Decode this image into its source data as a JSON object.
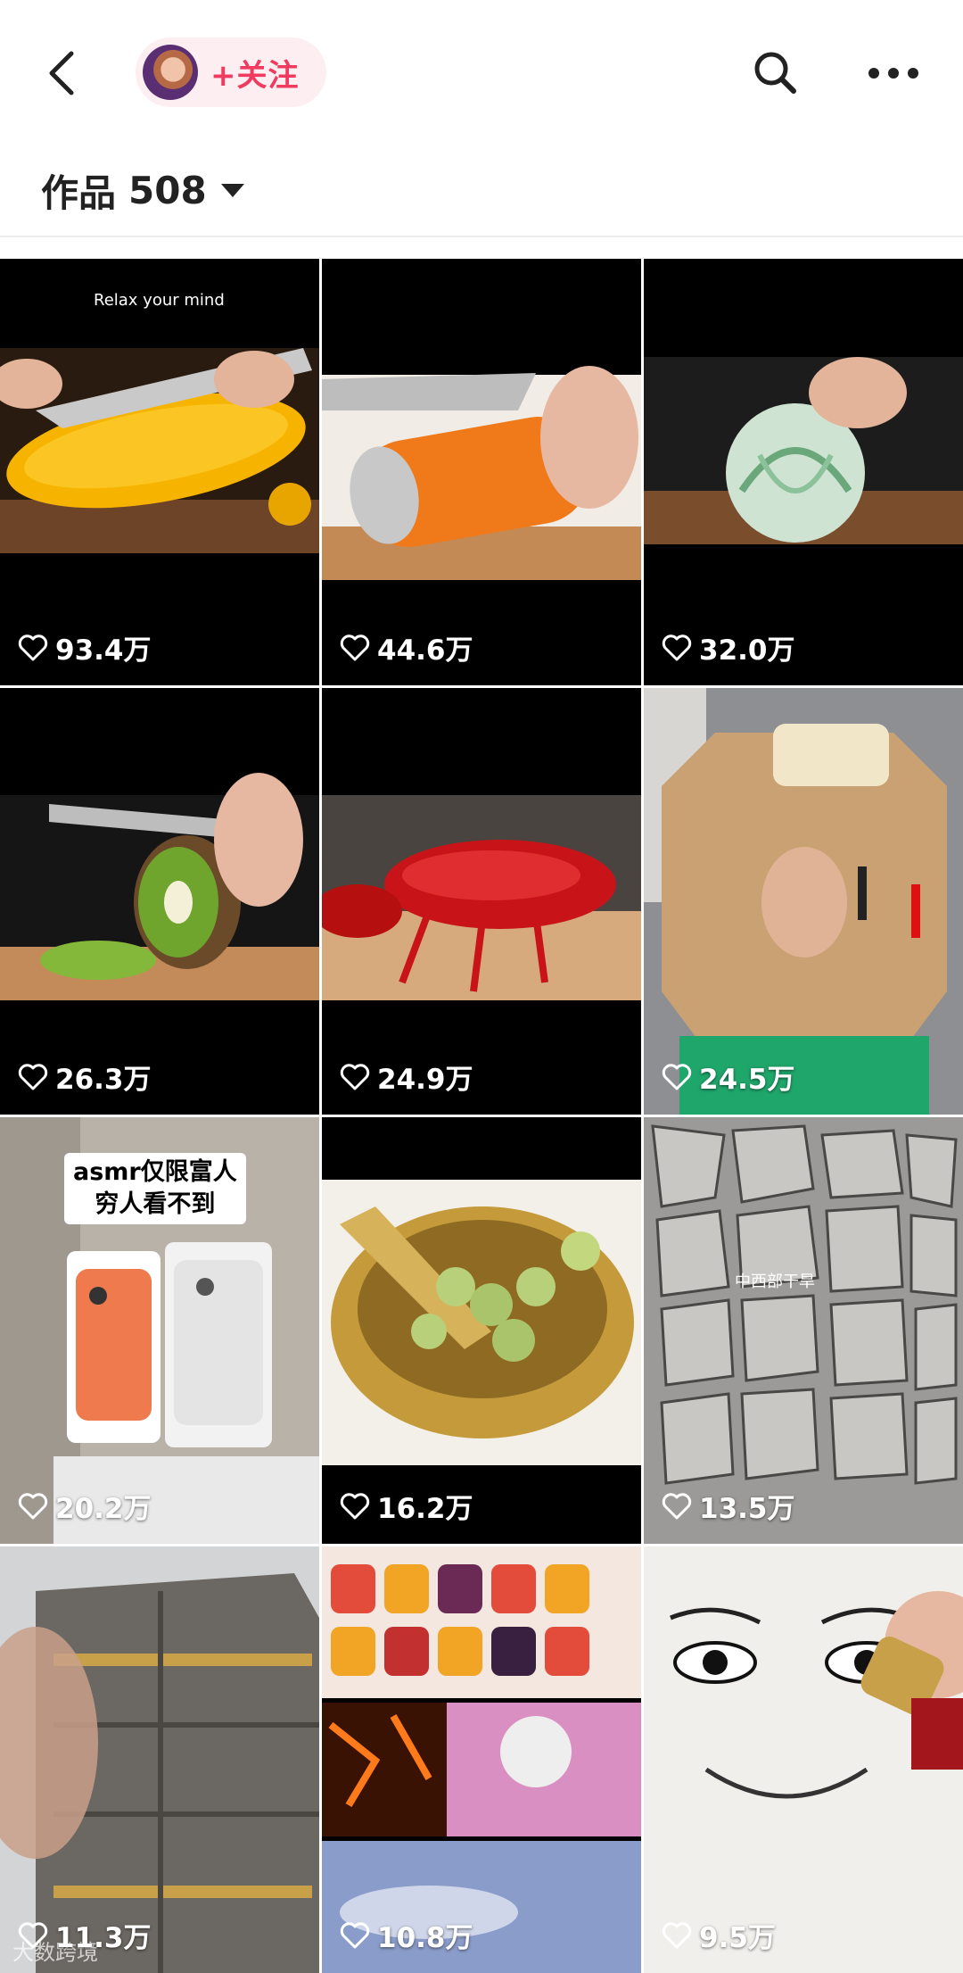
{
  "header": {
    "back_icon": "chevron-left-icon",
    "follow_label": "+关注",
    "search_icon": "search-icon",
    "more_icon": "more-horizontal-icon"
  },
  "section": {
    "label": "作品",
    "count": "508"
  },
  "colors": {
    "accent": "#f03a5f",
    "pill_bg": "#fdeef2",
    "text": "#222222"
  },
  "videos": [
    {
      "likes": "93.4万",
      "caption": "Relax your mind"
    },
    {
      "likes": "44.6万"
    },
    {
      "likes": "32.0万"
    },
    {
      "likes": "26.3万"
    },
    {
      "likes": "24.9万"
    },
    {
      "likes": "24.5万"
    },
    {
      "likes": "20.2万",
      "sticker_line1": "asmr仅限富人",
      "sticker_line2": "穷人看不到"
    },
    {
      "likes": "16.2万"
    },
    {
      "likes": "13.5万",
      "caption": "中西部干旱"
    },
    {
      "likes": "11.3万",
      "watermark": "大数跨境"
    },
    {
      "likes": "10.8万"
    },
    {
      "likes": "9.5万"
    }
  ]
}
